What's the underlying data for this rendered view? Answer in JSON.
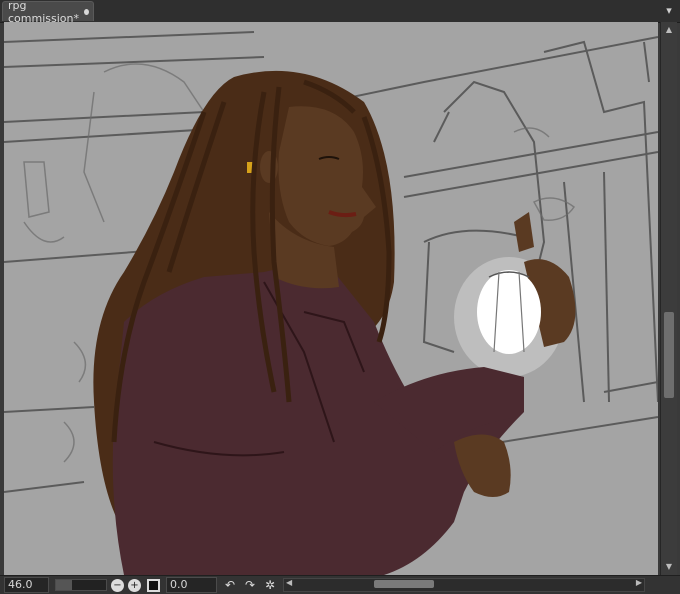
{
  "document_tab": {
    "label": "rpg commission*",
    "close_icon": "close-dot-icon"
  },
  "tabbar_menu_icon": "overflow-menu-icon",
  "canvas": {
    "background_color": "#a4a4a4",
    "artwork": "digital painting of a long-haired woman in a dark red coat holding a glowing lantern"
  },
  "statusbar": {
    "zoom_value": "46.0",
    "zoom_out_icon": "zoom-out-icon",
    "zoom_in_icon": "zoom-in-icon",
    "fit_icon": "fit-square-icon",
    "rotation_value": "0.0",
    "rotate_left_icon": "rotate-left-icon",
    "rotate_right_icon": "rotate-right-icon",
    "reset_icon": "reset-gear-icon"
  },
  "colors": {
    "skin": "#5a3a22",
    "coat": "#4b2a30",
    "hair": "#4a2c17",
    "lantern_glow": "#ffffff"
  }
}
